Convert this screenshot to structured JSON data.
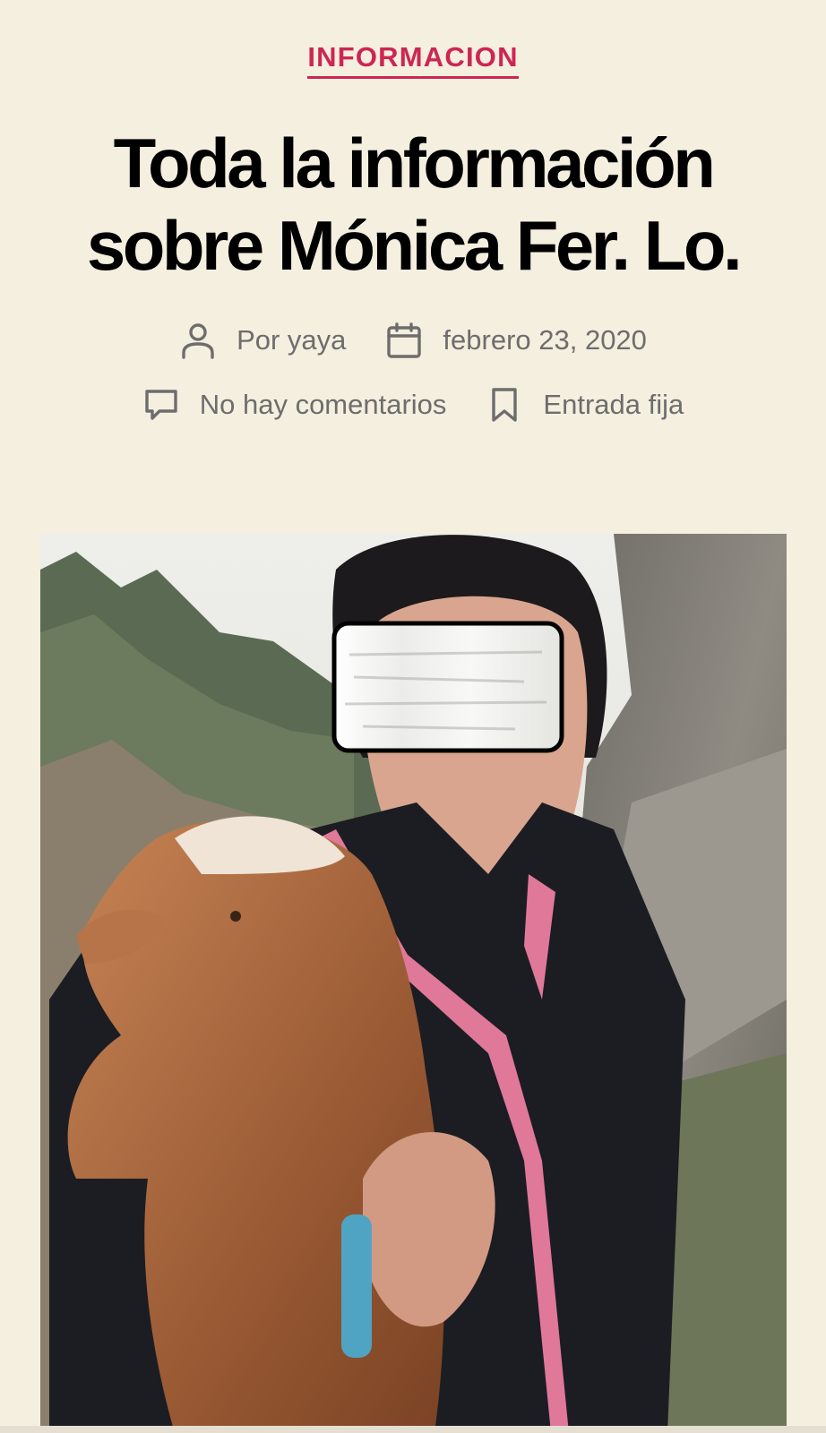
{
  "post": {
    "category": "INFORMACION",
    "title": "Toda la información sobre Mónica Fer. Lo.",
    "meta": {
      "author_label": "Por yaya",
      "date": "febrero 23, 2020",
      "comments": "No hay comentarios",
      "sticky": "Entrada fija"
    },
    "icons": {
      "author": "user-icon",
      "date": "calendar-icon",
      "comments": "comment-icon",
      "sticky": "bookmark-icon"
    }
  },
  "colors": {
    "background": "#f5efe0",
    "accent": "#cd2653",
    "meta_text": "#6d6d6d",
    "title": "#000000"
  }
}
